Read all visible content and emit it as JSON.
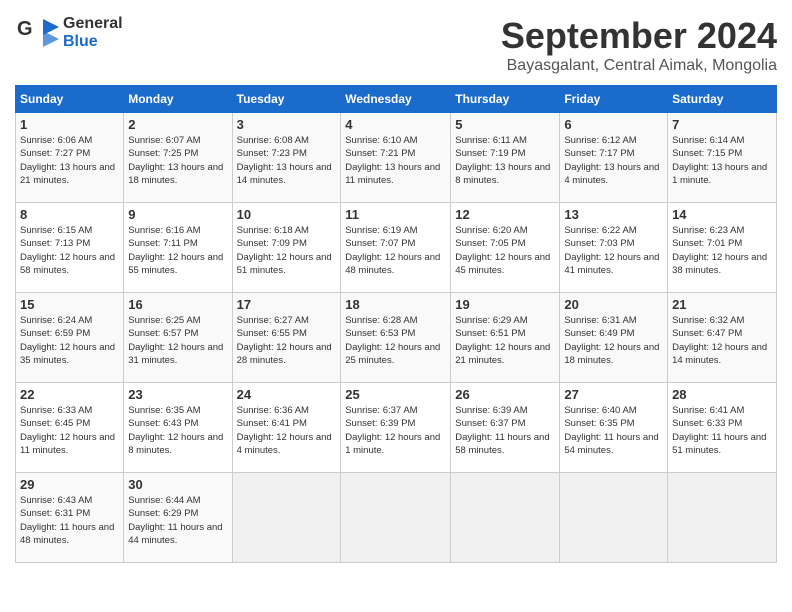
{
  "header": {
    "logo_line1": "General",
    "logo_line2": "Blue",
    "month_title": "September 2024",
    "subtitle": "Bayasgalant, Central Aimak, Mongolia"
  },
  "weekdays": [
    "Sunday",
    "Monday",
    "Tuesday",
    "Wednesday",
    "Thursday",
    "Friday",
    "Saturday"
  ],
  "weeks": [
    [
      {
        "day": "1",
        "sunrise": "6:06 AM",
        "sunset": "7:27 PM",
        "daylight": "13 hours and 21 minutes."
      },
      {
        "day": "2",
        "sunrise": "6:07 AM",
        "sunset": "7:25 PM",
        "daylight": "13 hours and 18 minutes."
      },
      {
        "day": "3",
        "sunrise": "6:08 AM",
        "sunset": "7:23 PM",
        "daylight": "13 hours and 14 minutes."
      },
      {
        "day": "4",
        "sunrise": "6:10 AM",
        "sunset": "7:21 PM",
        "daylight": "13 hours and 11 minutes."
      },
      {
        "day": "5",
        "sunrise": "6:11 AM",
        "sunset": "7:19 PM",
        "daylight": "13 hours and 8 minutes."
      },
      {
        "day": "6",
        "sunrise": "6:12 AM",
        "sunset": "7:17 PM",
        "daylight": "13 hours and 4 minutes."
      },
      {
        "day": "7",
        "sunrise": "6:14 AM",
        "sunset": "7:15 PM",
        "daylight": "13 hours and 1 minute."
      }
    ],
    [
      {
        "day": "8",
        "sunrise": "6:15 AM",
        "sunset": "7:13 PM",
        "daylight": "12 hours and 58 minutes."
      },
      {
        "day": "9",
        "sunrise": "6:16 AM",
        "sunset": "7:11 PM",
        "daylight": "12 hours and 55 minutes."
      },
      {
        "day": "10",
        "sunrise": "6:18 AM",
        "sunset": "7:09 PM",
        "daylight": "12 hours and 51 minutes."
      },
      {
        "day": "11",
        "sunrise": "6:19 AM",
        "sunset": "7:07 PM",
        "daylight": "12 hours and 48 minutes."
      },
      {
        "day": "12",
        "sunrise": "6:20 AM",
        "sunset": "7:05 PM",
        "daylight": "12 hours and 45 minutes."
      },
      {
        "day": "13",
        "sunrise": "6:22 AM",
        "sunset": "7:03 PM",
        "daylight": "12 hours and 41 minutes."
      },
      {
        "day": "14",
        "sunrise": "6:23 AM",
        "sunset": "7:01 PM",
        "daylight": "12 hours and 38 minutes."
      }
    ],
    [
      {
        "day": "15",
        "sunrise": "6:24 AM",
        "sunset": "6:59 PM",
        "daylight": "12 hours and 35 minutes."
      },
      {
        "day": "16",
        "sunrise": "6:25 AM",
        "sunset": "6:57 PM",
        "daylight": "12 hours and 31 minutes."
      },
      {
        "day": "17",
        "sunrise": "6:27 AM",
        "sunset": "6:55 PM",
        "daylight": "12 hours and 28 minutes."
      },
      {
        "day": "18",
        "sunrise": "6:28 AM",
        "sunset": "6:53 PM",
        "daylight": "12 hours and 25 minutes."
      },
      {
        "day": "19",
        "sunrise": "6:29 AM",
        "sunset": "6:51 PM",
        "daylight": "12 hours and 21 minutes."
      },
      {
        "day": "20",
        "sunrise": "6:31 AM",
        "sunset": "6:49 PM",
        "daylight": "12 hours and 18 minutes."
      },
      {
        "day": "21",
        "sunrise": "6:32 AM",
        "sunset": "6:47 PM",
        "daylight": "12 hours and 14 minutes."
      }
    ],
    [
      {
        "day": "22",
        "sunrise": "6:33 AM",
        "sunset": "6:45 PM",
        "daylight": "12 hours and 11 minutes."
      },
      {
        "day": "23",
        "sunrise": "6:35 AM",
        "sunset": "6:43 PM",
        "daylight": "12 hours and 8 minutes."
      },
      {
        "day": "24",
        "sunrise": "6:36 AM",
        "sunset": "6:41 PM",
        "daylight": "12 hours and 4 minutes."
      },
      {
        "day": "25",
        "sunrise": "6:37 AM",
        "sunset": "6:39 PM",
        "daylight": "12 hours and 1 minute."
      },
      {
        "day": "26",
        "sunrise": "6:39 AM",
        "sunset": "6:37 PM",
        "daylight": "11 hours and 58 minutes."
      },
      {
        "day": "27",
        "sunrise": "6:40 AM",
        "sunset": "6:35 PM",
        "daylight": "11 hours and 54 minutes."
      },
      {
        "day": "28",
        "sunrise": "6:41 AM",
        "sunset": "6:33 PM",
        "daylight": "11 hours and 51 minutes."
      }
    ],
    [
      {
        "day": "29",
        "sunrise": "6:43 AM",
        "sunset": "6:31 PM",
        "daylight": "11 hours and 48 minutes."
      },
      {
        "day": "30",
        "sunrise": "6:44 AM",
        "sunset": "6:29 PM",
        "daylight": "11 hours and 44 minutes."
      },
      null,
      null,
      null,
      null,
      null
    ]
  ]
}
